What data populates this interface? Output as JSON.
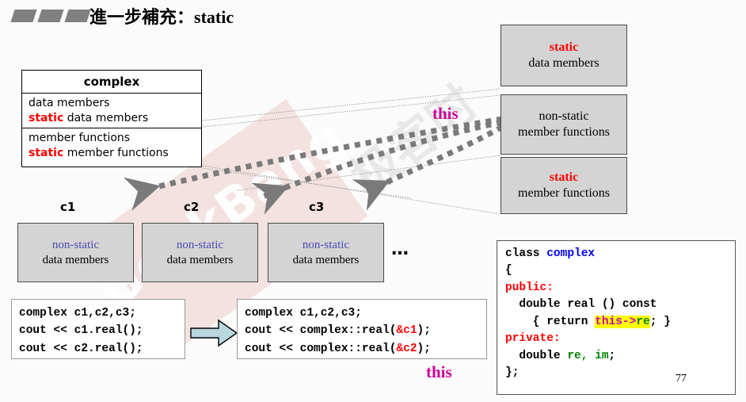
{
  "slide": {
    "title_cn": "進一步補充：",
    "title_kw": "static",
    "page_number": "77"
  },
  "class_box": {
    "name": "complex",
    "section_data": [
      {
        "plain": "data members"
      },
      {
        "kw": "static",
        "plain": " data members"
      }
    ],
    "section_functions": [
      {
        "plain": "member functions"
      },
      {
        "kw": "static",
        "plain": " member functions"
      }
    ]
  },
  "right_boxes": [
    {
      "id": "static-data",
      "kw": "static",
      "line2": "data members"
    },
    {
      "id": "nonstatic-functions",
      "line1": "non-static",
      "line2": "member functions"
    },
    {
      "id": "static-functions",
      "kw": "static",
      "line2": "member functions"
    }
  ],
  "instances": [
    {
      "label": "c1",
      "line1": "non-static",
      "line2": "data members"
    },
    {
      "label": "c2",
      "line1": "non-static",
      "line2": "data members"
    },
    {
      "label": "c3",
      "line1": "non-static",
      "line2": "data members"
    }
  ],
  "ellipsis": "…",
  "code_before": {
    "line1": "complex c1,c2,c3;",
    "line2": "cout << c1.real();",
    "line3": "cout << c2.real();"
  },
  "code_after": {
    "line1": "complex c1,c2,c3;",
    "line2_a": "cout << complex::real(",
    "line2_ref": "&c1",
    "line2_b": ");",
    "line3_a": "cout << complex::real(",
    "line3_ref": "&c2",
    "line3_b": ");"
  },
  "code_class": {
    "l1_kw": "class ",
    "l1_name": "complex",
    "l2": "{",
    "l3": "public:",
    "l4": "  double real () const",
    "l5_a": "    { return ",
    "l5_this": "this->",
    "l5_re": "re",
    "l5_b": "; }",
    "l6": "private:",
    "l7_a": "  double ",
    "l7_vars": "re, im",
    "l7_b": ";",
    "l8": "};"
  },
  "annotations": {
    "this_top": "this",
    "this_bottom": "this"
  },
  "watermark": {
    "brand": "GeekBang",
    "cn": "极客时"
  },
  "colors": {
    "keyword_red": "#ff0000",
    "nonstatic_blue": "#4a4ab4",
    "this_magenta": "#cc0099",
    "box_gray": "#d4d4d4",
    "highlight_yellow": "#ffff00",
    "flow_arrow_blue": "#b9d7dd"
  }
}
